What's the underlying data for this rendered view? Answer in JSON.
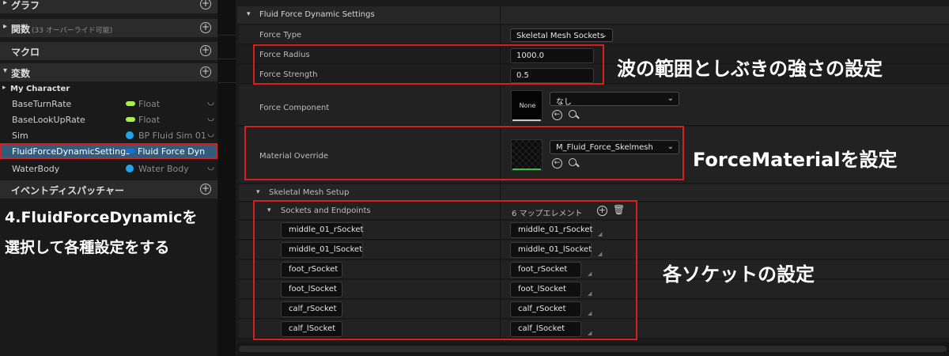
{
  "left_panel": {
    "sections": {
      "graph": "グラフ",
      "functions": "関数",
      "functions_count": "(33 オーバーライド可能)",
      "macros": "マクロ",
      "variables": "変数",
      "event_dispatchers": "イベントディスパッチャー"
    },
    "group": "My Character",
    "variables": [
      {
        "name": "BaseTurnRate",
        "type": "Float",
        "color": "#a8f04b"
      },
      {
        "name": "BaseLookUpRate",
        "type": "Float",
        "color": "#a8f04b"
      },
      {
        "name": "Sim",
        "type": "BP Fluid Sim 01",
        "color": "#1fa4e8"
      },
      {
        "name": "FluidForceDynamicSettings",
        "type": "Fluid Force Dyn",
        "color": "#1a6fd4"
      },
      {
        "name": "WaterBody",
        "type": "Water Body",
        "color": "#1fa4e8"
      }
    ],
    "annotation_line1": "4.FluidForceDynamicを",
    "annotation_line2": "選択して各種設定をする"
  },
  "details": {
    "category": "Fluid Force Dynamic Settings",
    "force_type": {
      "label": "Force Type",
      "value": "Skeletal Mesh Sockets"
    },
    "force_radius": {
      "label": "Force Radius",
      "value": "1000.0"
    },
    "force_strength": {
      "label": "Force Strength",
      "value": "0.5"
    },
    "force_component": {
      "label": "Force Component",
      "thumb_text": "None",
      "value": "なし"
    },
    "material_override": {
      "label": "Material Override",
      "value": "M_Fluid_Force_Skelmesh"
    },
    "skeletal_mesh_setup": "Skeletal Mesh Setup",
    "sockets_and_endpoints": {
      "label": "Sockets and Endpoints",
      "count": "6 マップエレメント"
    },
    "sockets": [
      {
        "key": "middle_01_rSocket",
        "value": "middle_01_rSocket"
      },
      {
        "key": "middle_01_lSocket",
        "value": "middle_01_lSocket"
      },
      {
        "key": "foot_rSocket",
        "value": "foot_rSocket"
      },
      {
        "key": "foot_lSocket",
        "value": "foot_lSocket"
      },
      {
        "key": "calf_rSocket",
        "value": "calf_rSocket"
      },
      {
        "key": "calf_lSocket",
        "value": "calf_lSocket"
      }
    ]
  },
  "annotations": {
    "wave": "波の範囲としぶきの強さの設定",
    "material": "ForceMaterialを設定",
    "sockets": "各ソケットの設定"
  },
  "colors": {
    "highlight_red": "#d81e1e",
    "selected_row": "#335b7c"
  }
}
